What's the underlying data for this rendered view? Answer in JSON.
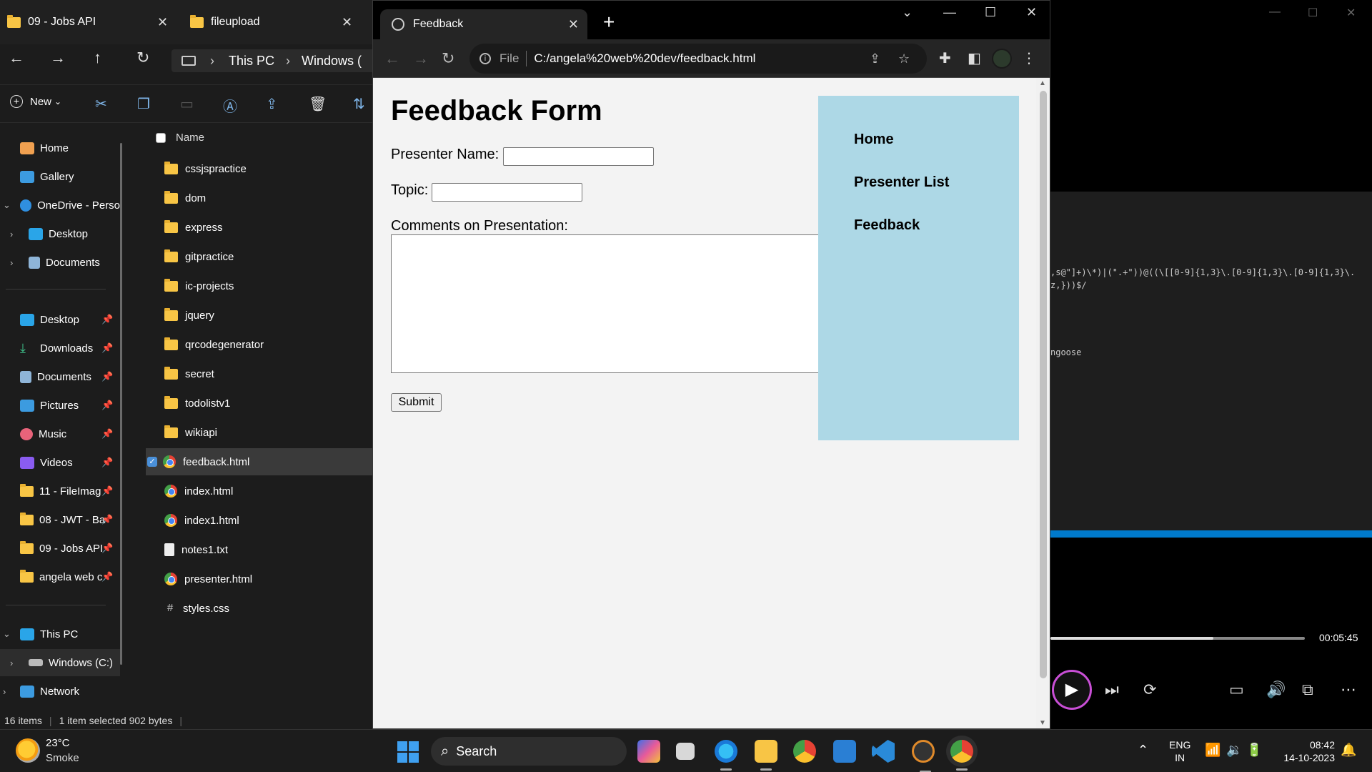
{
  "explorer": {
    "tabs": [
      {
        "title": "09 - Jobs API",
        "close": "✕"
      },
      {
        "title": "fileupload",
        "close": "✕"
      }
    ],
    "nav_icons": {
      "back": "←",
      "forward": "→",
      "up": "↑",
      "refresh": "↻"
    },
    "breadcrumb": {
      "root": "This PC",
      "drive": "Windows (",
      "sep": "›"
    },
    "toolbar": {
      "new_label": "New",
      "new_chevron": "⌄"
    },
    "sidebar": {
      "home": "Home",
      "gallery": "Gallery",
      "onedrive": "OneDrive - Perso",
      "od_desktop": "Desktop",
      "od_documents": "Documents",
      "quick": [
        {
          "label": "Desktop"
        },
        {
          "label": "Downloads"
        },
        {
          "label": "Documents"
        },
        {
          "label": "Pictures"
        },
        {
          "label": "Music"
        },
        {
          "label": "Videos"
        },
        {
          "label": "11 - FileImag"
        },
        {
          "label": "08 - JWT - Ba"
        },
        {
          "label": "09 - Jobs API"
        },
        {
          "label": "angela web c"
        }
      ],
      "this_pc": "This PC",
      "windows_c": "Windows (C:)",
      "network": "Network",
      "pin": "📌"
    },
    "files_header": "Name",
    "files": [
      {
        "name": "cssjspractice",
        "type": "folder"
      },
      {
        "name": "dom",
        "type": "folder"
      },
      {
        "name": "express",
        "type": "folder"
      },
      {
        "name": "gitpractice",
        "type": "folder"
      },
      {
        "name": "ic-projects",
        "type": "folder"
      },
      {
        "name": "jquery",
        "type": "folder"
      },
      {
        "name": "qrcodegenerator",
        "type": "folder"
      },
      {
        "name": "secret",
        "type": "folder"
      },
      {
        "name": "todolistv1",
        "type": "folder"
      },
      {
        "name": "wikiapi",
        "type": "folder"
      },
      {
        "name": "feedback.html",
        "type": "chrome",
        "selected": true
      },
      {
        "name": "index.html",
        "type": "chrome"
      },
      {
        "name": "index1.html",
        "type": "chrome"
      },
      {
        "name": "notes1.txt",
        "type": "txt"
      },
      {
        "name": "presenter.html",
        "type": "chrome"
      },
      {
        "name": "styles.css",
        "type": "css"
      }
    ],
    "status": {
      "items": "16 items",
      "selected": "1 item selected  902 bytes"
    }
  },
  "chrome": {
    "tab_title": "Feedback",
    "tab_close": "✕",
    "new_tab": "+",
    "omnibox": {
      "scheme_label": "File",
      "url": "C:/angela%20web%20dev/feedback.html"
    },
    "window_controls": {
      "min": "—",
      "max": "☐",
      "close": "✕",
      "tabsearch": "⌄"
    }
  },
  "page": {
    "title": "Feedback Form",
    "presenter_label": "Presenter Name:",
    "topic_label": "Topic:",
    "comments_label": "Comments on Presentation:",
    "submit_label": "Submit",
    "nav": [
      "Home",
      "Presenter List",
      "Feedback"
    ]
  },
  "video": {
    "code_line_1": ",s@\"]+)\\*)|(\".+\"))@((\\[[0-9]{1,3}\\.[0-9]{1,3}\\.[0-9]{1,3}\\.",
    "code_line_2": "z,}))$/",
    "code_line_3": "ngoose",
    "time": "00:05:45",
    "progress_fraction": 0.64
  },
  "taskbar": {
    "temperature": "23°C",
    "condition": "Smoke",
    "search_label": "Search",
    "lang_1": "ENG",
    "lang_2": "IN",
    "time": "08:42",
    "date": "14-10-2023"
  }
}
